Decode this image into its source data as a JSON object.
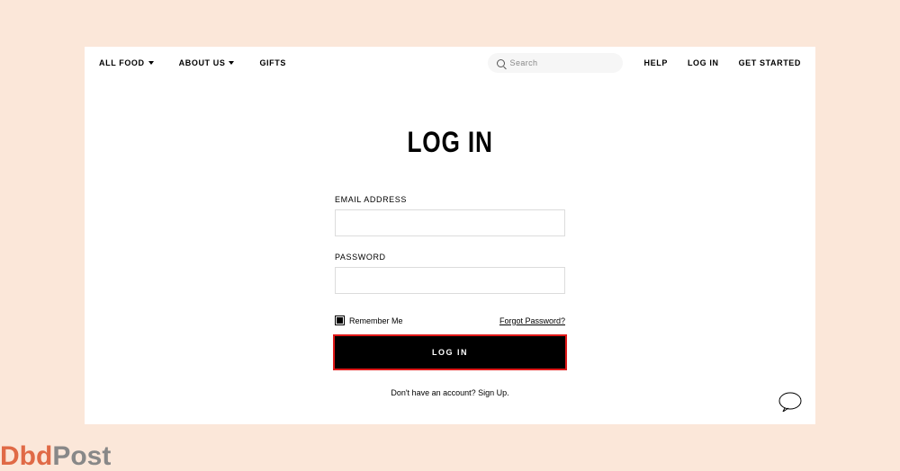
{
  "nav": {
    "left": {
      "all_food": "ALL FOOD",
      "about_us": "ABOUT US",
      "gifts": "GIFTS"
    },
    "search_placeholder": "Search",
    "right": {
      "help": "HELP",
      "log_in": "LOG IN",
      "get_started": "GET STARTED"
    }
  },
  "heading": "LOG IN",
  "form": {
    "email_label": "EMAIL ADDRESS",
    "email_value": "",
    "password_label": "PASSWORD",
    "password_value": "",
    "remember_label": "Remember Me",
    "remember_checked": true,
    "forgot_label": "Forgot Password?",
    "submit_label": "LOG IN",
    "signup_prompt": "Don't have an account? ",
    "signup_link": "Sign Up."
  },
  "watermark": {
    "a": "Dbd",
    "b": "Post"
  }
}
